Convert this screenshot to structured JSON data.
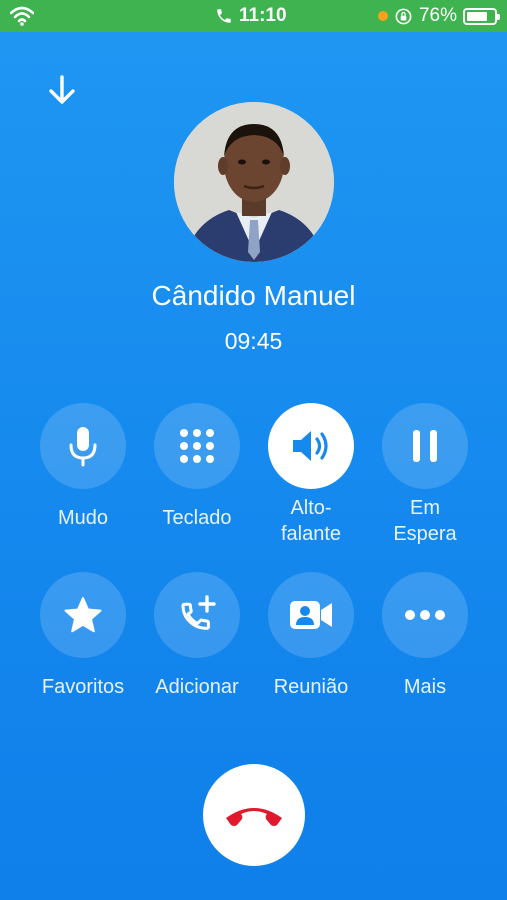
{
  "status_bar": {
    "time": "11:10",
    "battery_percent": "76%",
    "battery_level": 0.76,
    "icons": [
      "wifi-icon",
      "phone-icon",
      "recording-dot",
      "rotation-lock-icon",
      "battery-icon"
    ]
  },
  "call": {
    "caller_name": "Cândido Manuel",
    "duration": "09:45"
  },
  "actions": [
    {
      "label": "Mudo",
      "icon": "microphone-icon",
      "active": false
    },
    {
      "label": "Teclado",
      "icon": "keypad-icon",
      "active": false
    },
    {
      "label": "Alto-\nfalante",
      "icon": "speaker-icon",
      "active": true
    },
    {
      "label": "Em\nEspera",
      "icon": "pause-icon",
      "active": false
    },
    {
      "label": "Favoritos",
      "icon": "star-icon",
      "active": false
    },
    {
      "label": "Adicionar",
      "icon": "add-call-icon",
      "active": false
    },
    {
      "label": "Reunião",
      "icon": "video-meeting-icon",
      "active": false
    },
    {
      "label": "Mais",
      "icon": "more-icon",
      "active": false
    }
  ],
  "colors": {
    "status_bar": "#3fb34f",
    "background": "#1589ee",
    "end_call_icon": "#e0192d"
  }
}
